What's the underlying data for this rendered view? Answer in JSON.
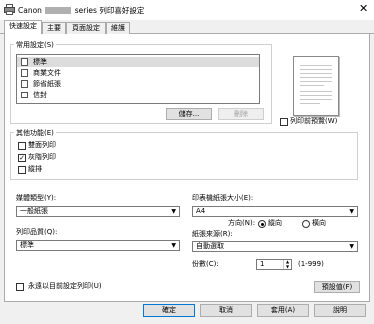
{
  "window": {
    "title_prefix": "Canon",
    "title_suffix": "series 列印喜好設定",
    "close": "✕"
  },
  "tabs": [
    "快速設定",
    "主要",
    "頁面設定",
    "維護"
  ],
  "common_settings": {
    "label": "常用設定(S)",
    "items": [
      "標準",
      "商業文件",
      "節省紙張",
      "信封"
    ],
    "save_button": "儲存...",
    "delete_button": "刪除"
  },
  "preview_checkbox": {
    "label": "列印前預覽(W)",
    "checked": false
  },
  "other_features": {
    "label": "其他功能(E)",
    "items": [
      {
        "label": "雙面列印",
        "checked": false
      },
      {
        "label": "灰階列印",
        "checked": true
      },
      {
        "label": "縱排",
        "checked": false
      }
    ]
  },
  "media_type": {
    "label": "媒體類型(Y):",
    "value": "一般紙張"
  },
  "paper_size": {
    "label": "印表機紙張大小(E):",
    "value": "A4"
  },
  "orientation": {
    "label": "方向(N):",
    "portrait": "縱向",
    "landscape": "橫向",
    "selected": "portrait"
  },
  "print_quality": {
    "label": "列印品質(Q):",
    "value": "標準"
  },
  "paper_source": {
    "label": "紙張來源(R):",
    "value": "自動選取"
  },
  "copies": {
    "label": "份數(C):",
    "value": "1",
    "range": "(1-999)"
  },
  "always_print": {
    "label": "永遠以目前設定列印(U)",
    "checked": false
  },
  "defaults_button": "預設值(F)",
  "footer": {
    "ok": "確定",
    "cancel": "取消",
    "apply": "套用(A)",
    "help": "說明"
  }
}
